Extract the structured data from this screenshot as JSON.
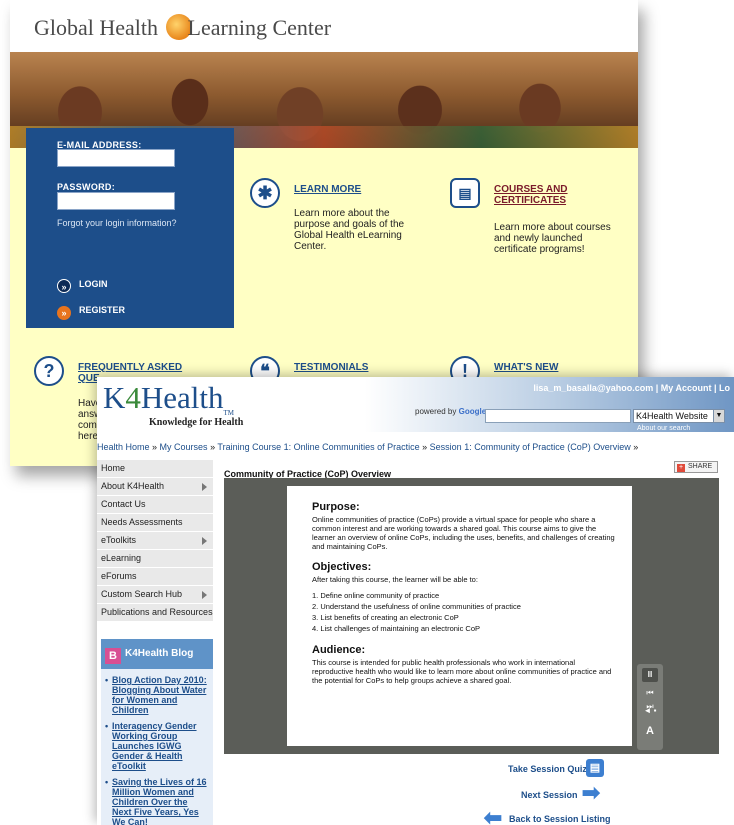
{
  "elearning": {
    "brand": {
      "left": "Global Health",
      "right": "Learning Center"
    },
    "login": {
      "email_label": "E-MAIL ADDRESS:",
      "password_label": "PASSWORD:",
      "forgot_label": "Forgot your login information?",
      "login_label": "LOGIN",
      "register_label": "REGISTER"
    },
    "features": {
      "learn_more": {
        "title": "Learn More",
        "desc": "Learn more about the purpose and goals of the Global Health eLearning Center."
      },
      "courses": {
        "title": "Courses and Certificates",
        "desc": "Learn more about courses and newly launched certificate programs!"
      },
      "faq": {
        "title": "Frequently Asked Que",
        "desc_lines": [
          "Have",
          "answ",
          "comr",
          "here!"
        ]
      },
      "testimonials": {
        "title": "Testimonials"
      },
      "whats_new": {
        "title": "What's New"
      }
    }
  },
  "k4health": {
    "logo": {
      "k": "K",
      "four": "4",
      "rest": "Health",
      "tm": "TM"
    },
    "tagline": "Knowledge for Health",
    "user_links": {
      "email": "lisa_m_basalla@yahoo.com",
      "account": "My Account",
      "logout": "Lo"
    },
    "search": {
      "powered_by": "powered by",
      "google": "Google",
      "scope": "K4Health Website",
      "about": "About our search"
    },
    "breadcrumb": [
      "Health Home",
      "My Courses",
      "Training Course 1: Online Communities of Practice",
      "Session 1: Community of Practice (CoP) Overview"
    ],
    "nav": [
      {
        "label": "Home",
        "sub": false
      },
      {
        "label": "About K4Health",
        "sub": true
      },
      {
        "label": "Contact Us",
        "sub": false
      },
      {
        "label": "Needs Assessments",
        "sub": false
      },
      {
        "label": "eToolkits",
        "sub": true
      },
      {
        "label": "eLearning",
        "sub": false
      },
      {
        "label": "eForums",
        "sub": false
      },
      {
        "label": "Custom Search Hub",
        "sub": true
      },
      {
        "label": "Publications and Resources",
        "sub": false
      }
    ],
    "blog": {
      "title": "K4Health Blog",
      "posts": [
        "Blog Action Day 2010: Blogging About Water for Women and Children",
        "Interagency Gender Working Group Launches IGWG Gender & Health eToolkit",
        "Saving the Lives of 16 Million Women and Children Over the Next Five Years, Yes We Can!"
      ]
    },
    "page_title": "Community of Practice (CoP) Overview",
    "share_label": "SHARE",
    "slide": {
      "purpose_heading": "Purpose:",
      "purpose_text": "Online communities of practice (CoPs) provide a virtual space for people who share a common interest and are working towards a shared goal. This course aims to give the learner an overview of online CoPs, including the uses, benefits, and challenges of creating and maintaining CoPs.",
      "objectives_heading": "Objectives:",
      "objectives_intro": "After taking this course, the learner will be able to:",
      "objectives": [
        "1. Define online community of practice",
        "2. Understand the usefulness of online communities of practice",
        "3. List benefits of creating an electronic CoP",
        "4. List challenges of maintaining an electronic CoP"
      ],
      "audience_heading": "Audience:",
      "audience_text": "This course is intended for public health professionals who work in international reproductive health who would like to learn more about online communities of practice and the potential for CoPs to help groups achieve a shared goal."
    },
    "actions": {
      "quiz": "Take Session Quiz",
      "next": "Next Session",
      "back": "Back to Session Listing"
    }
  }
}
